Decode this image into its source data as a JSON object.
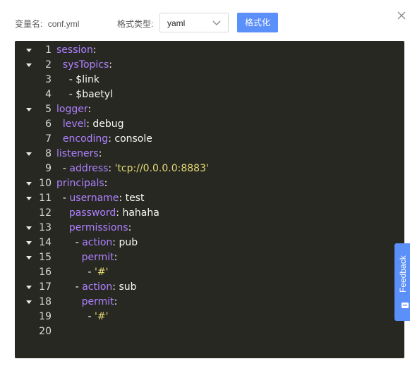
{
  "header": {
    "var_label": "变量名:",
    "var_value": "conf.yml",
    "format_label": "格式类型:",
    "format_select_value": "yaml",
    "format_button": "格式化"
  },
  "editor": {
    "lines": [
      {
        "n": "1",
        "fold": true,
        "tokens": [
          {
            "t": "session",
            "c": "key"
          },
          {
            "t": ":",
            "c": "punct"
          }
        ]
      },
      {
        "n": "2",
        "fold": true,
        "tokens": [
          {
            "t": "  ",
            "c": "plain"
          },
          {
            "t": "sysTopics",
            "c": "key"
          },
          {
            "t": ":",
            "c": "punct"
          }
        ]
      },
      {
        "n": "3",
        "fold": false,
        "tokens": [
          {
            "t": "    - $link",
            "c": "plain"
          }
        ]
      },
      {
        "n": "4",
        "fold": false,
        "tokens": [
          {
            "t": "    - $baetyl",
            "c": "plain"
          }
        ]
      },
      {
        "n": "5",
        "fold": true,
        "tokens": [
          {
            "t": "logger",
            "c": "key"
          },
          {
            "t": ":",
            "c": "punct"
          }
        ]
      },
      {
        "n": "6",
        "fold": false,
        "tokens": [
          {
            "t": "  ",
            "c": "plain"
          },
          {
            "t": "level",
            "c": "key"
          },
          {
            "t": ": debug",
            "c": "plain"
          }
        ]
      },
      {
        "n": "7",
        "fold": false,
        "tokens": [
          {
            "t": "  ",
            "c": "plain"
          },
          {
            "t": "encoding",
            "c": "key"
          },
          {
            "t": ": console",
            "c": "plain"
          }
        ]
      },
      {
        "n": "8",
        "fold": true,
        "tokens": [
          {
            "t": "listeners",
            "c": "key"
          },
          {
            "t": ":",
            "c": "punct"
          }
        ]
      },
      {
        "n": "9",
        "fold": false,
        "tokens": [
          {
            "t": "  - ",
            "c": "plain"
          },
          {
            "t": "address",
            "c": "key"
          },
          {
            "t": ": ",
            "c": "plain"
          },
          {
            "t": "'tcp://0.0.0.0:8883'",
            "c": "str"
          }
        ]
      },
      {
        "n": "10",
        "fold": true,
        "tokens": [
          {
            "t": "principals",
            "c": "key"
          },
          {
            "t": ":",
            "c": "punct"
          }
        ]
      },
      {
        "n": "11",
        "fold": true,
        "tokens": [
          {
            "t": "  - ",
            "c": "plain"
          },
          {
            "t": "username",
            "c": "key"
          },
          {
            "t": ": test",
            "c": "plain"
          }
        ]
      },
      {
        "n": "12",
        "fold": false,
        "tokens": [
          {
            "t": "    ",
            "c": "plain"
          },
          {
            "t": "password",
            "c": "key"
          },
          {
            "t": ": hahaha",
            "c": "plain"
          }
        ]
      },
      {
        "n": "13",
        "fold": true,
        "tokens": [
          {
            "t": "    ",
            "c": "plain"
          },
          {
            "t": "permissions",
            "c": "key"
          },
          {
            "t": ":",
            "c": "punct"
          }
        ]
      },
      {
        "n": "14",
        "fold": true,
        "tokens": [
          {
            "t": "      - ",
            "c": "plain"
          },
          {
            "t": "action",
            "c": "key"
          },
          {
            "t": ": pub",
            "c": "plain"
          }
        ]
      },
      {
        "n": "15",
        "fold": true,
        "tokens": [
          {
            "t": "        ",
            "c": "plain"
          },
          {
            "t": "permit",
            "c": "key"
          },
          {
            "t": ":",
            "c": "punct"
          }
        ]
      },
      {
        "n": "16",
        "fold": false,
        "tokens": [
          {
            "t": "          - ",
            "c": "plain"
          },
          {
            "t": "'#'",
            "c": "str"
          }
        ]
      },
      {
        "n": "17",
        "fold": true,
        "tokens": [
          {
            "t": "      - ",
            "c": "plain"
          },
          {
            "t": "action",
            "c": "key"
          },
          {
            "t": ": sub",
            "c": "plain"
          }
        ]
      },
      {
        "n": "18",
        "fold": true,
        "tokens": [
          {
            "t": "        ",
            "c": "plain"
          },
          {
            "t": "permit",
            "c": "key"
          },
          {
            "t": ":",
            "c": "punct"
          }
        ]
      },
      {
        "n": "19",
        "fold": false,
        "tokens": [
          {
            "t": "          - ",
            "c": "plain"
          },
          {
            "t": "'#'",
            "c": "str"
          }
        ]
      },
      {
        "n": "20",
        "fold": false,
        "tokens": []
      }
    ]
  },
  "feedback": {
    "label": "Feedback"
  },
  "colors": {
    "accent": "#5b8ff9",
    "editor_bg": "#272822",
    "key": "#ae81ff",
    "string": "#e6db74",
    "text": "#f8f8f2"
  },
  "icons": {
    "close": "close-icon",
    "dropdown": "chevron-down-icon",
    "fold": "fold-arrow-icon",
    "feedback": "feedback-icon"
  }
}
